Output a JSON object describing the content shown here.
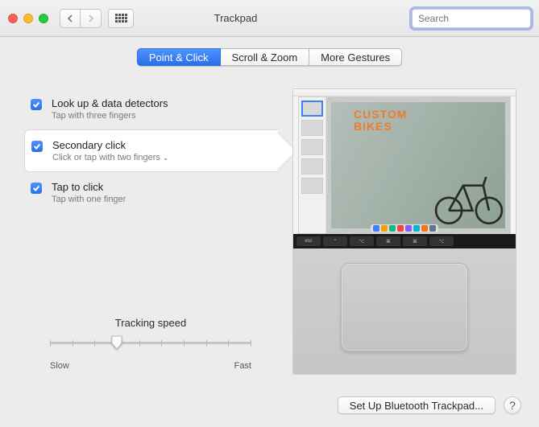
{
  "window": {
    "title": "Trackpad",
    "search_placeholder": "Search"
  },
  "tabs": [
    {
      "label": "Point & Click",
      "selected": true
    },
    {
      "label": "Scroll & Zoom",
      "selected": false
    },
    {
      "label": "More Gestures",
      "selected": false
    }
  ],
  "options": [
    {
      "title": "Look up & data detectors",
      "subtitle": "Tap with three fingers",
      "checked": true,
      "has_dropdown": false,
      "active": false
    },
    {
      "title": "Secondary click",
      "subtitle": "Click or tap with two fingers",
      "checked": true,
      "has_dropdown": true,
      "active": true
    },
    {
      "title": "Tap to click",
      "subtitle": "Tap with one finger",
      "checked": true,
      "has_dropdown": false,
      "active": false
    }
  ],
  "slider": {
    "label": "Tracking speed",
    "min_label": "Slow",
    "max_label": "Fast",
    "ticks": 10,
    "value_index": 3
  },
  "footer": {
    "setup_button": "Set Up Bluetooth Trackpad...",
    "help": "?"
  },
  "preview": {
    "headline_line1": "CUSTOM",
    "headline_line2": "BIKES",
    "touchbar_keys": [
      "esc",
      "⌃",
      "⌥",
      "⌘",
      "⌘",
      "⌥"
    ]
  }
}
